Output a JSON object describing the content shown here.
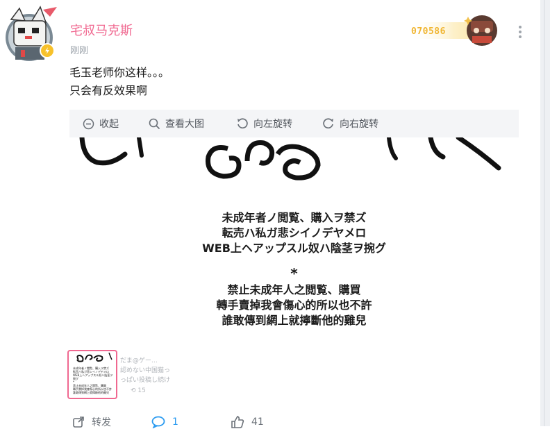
{
  "post": {
    "username": "宅叔马克斯",
    "timestamp": "刚刚",
    "fan_number": "070586",
    "text_line1": "毛玉老师你这样。。。",
    "text_line2": "只会有反效果啊"
  },
  "toolbar": {
    "collapse": "收起",
    "view_large": "查看大图",
    "rotate_left": "向左旋转",
    "rotate_right": "向右旋转"
  },
  "image": {
    "jp_line1": "未成年者ノ閲覧、購入ヲ禁ズ",
    "jp_line2": "転売ハ私ガ悲シイノデヤメロ",
    "jp_line3": "WEB上ヘアップスル奴ハ陰茎ヲ捥グ",
    "star": "*",
    "cn_line1": "禁止未成年人之閲覧、購買",
    "cn_line2": "轉手賣掉我會傷心的所以也不許",
    "cn_line3": "誰敢傳到網上就擰斷他的雞兒"
  },
  "watermark": {
    "line1": "だま@ゲー…",
    "line2": "認めない中国猫っ",
    "line3": "っぱい投稿し続け",
    "line4": "⟲ 15"
  },
  "actions": {
    "repost_label": "转发",
    "comment_count": "1",
    "like_count": "41"
  },
  "colors": {
    "username": "#f06890",
    "fan_number": "#f0b530",
    "comment_accent": "#2b9bf0"
  }
}
